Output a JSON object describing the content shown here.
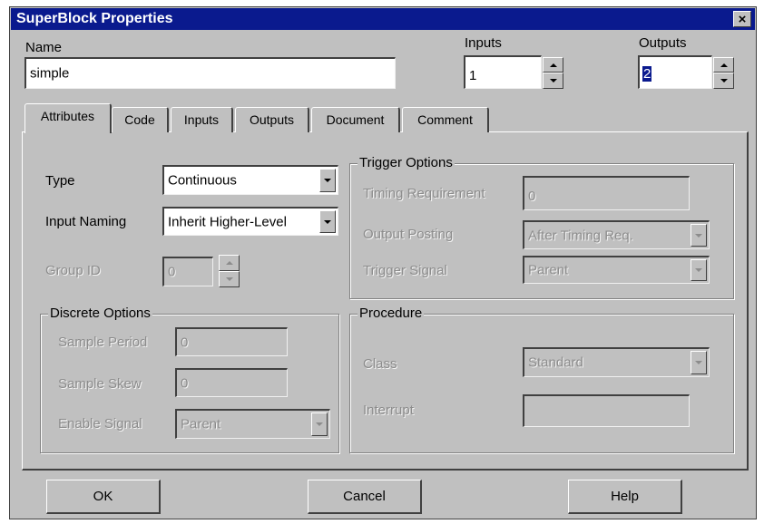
{
  "window": {
    "title": "SuperBlock Properties",
    "close_label": "×"
  },
  "name": {
    "label": "Name",
    "value": "simple"
  },
  "inputs": {
    "label": "Inputs",
    "value": "1"
  },
  "outputs": {
    "label": "Outputs",
    "value": "2"
  },
  "tabs": [
    {
      "label": "Attributes",
      "active": true
    },
    {
      "label": "Code"
    },
    {
      "label": "Inputs"
    },
    {
      "label": "Outputs"
    },
    {
      "label": "Document"
    },
    {
      "label": "Comment"
    }
  ],
  "attributes": {
    "type": {
      "label": "Type",
      "value": "Continuous"
    },
    "input_naming": {
      "label": "Input Naming",
      "value": "Inherit Higher-Level"
    },
    "group_id": {
      "label": "Group ID",
      "value": "0"
    }
  },
  "discrete_options": {
    "title": "Discrete Options",
    "sample_period": {
      "label": "Sample Period",
      "value": "0"
    },
    "sample_skew": {
      "label": "Sample Skew",
      "value": "0"
    },
    "enable_signal": {
      "label": "Enable Signal",
      "value": "Parent"
    }
  },
  "trigger_options": {
    "title": "Trigger Options",
    "timing_requirement": {
      "label": "Timing Requirement",
      "value": "0"
    },
    "output_posting": {
      "label": "Output Posting",
      "value": "After Timing Req."
    },
    "trigger_signal": {
      "label": "Trigger Signal",
      "value": "Parent"
    }
  },
  "procedure": {
    "title": "Procedure",
    "class": {
      "label": "Class",
      "value": "Standard"
    },
    "interrupt": {
      "label": "Interrupt",
      "value": ""
    }
  },
  "buttons": {
    "ok": "OK",
    "cancel": "Cancel",
    "help": "Help"
  }
}
